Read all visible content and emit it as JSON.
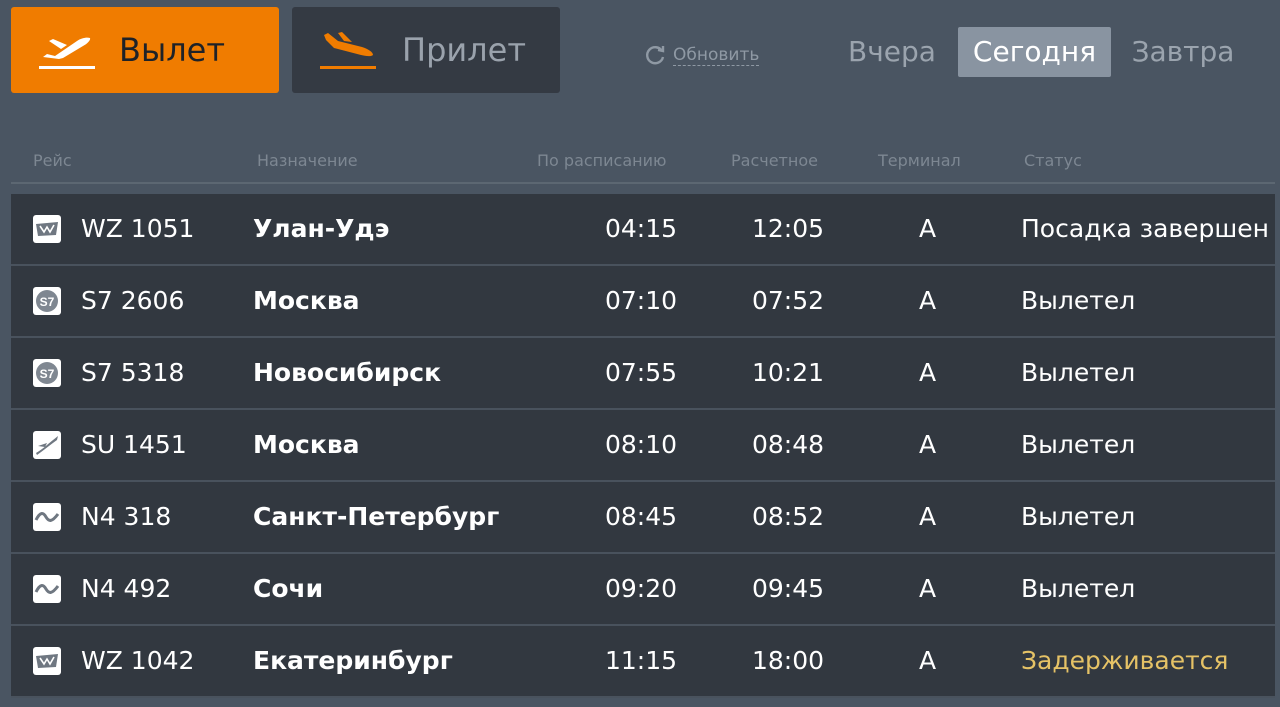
{
  "tabs": {
    "departure_label": "Вылет",
    "arrival_label": "Прилет"
  },
  "refresh_label": "Обновить",
  "days": {
    "yesterday": "Вчера",
    "today": "Сегодня",
    "tomorrow": "Завтра"
  },
  "columns": {
    "flight": "Рейс",
    "destination": "Назначение",
    "scheduled": "По расписанию",
    "estimated": "Расчетное",
    "terminal": "Терминал",
    "status": "Статус"
  },
  "colors": {
    "accent": "#f07c00",
    "delayed": "#e5c266"
  },
  "flights": [
    {
      "logo": "wz-logo-icon",
      "flight": "WZ 1051",
      "destination": "Улан-Удэ",
      "scheduled": "04:15",
      "estimated": "12:05",
      "terminal": "A",
      "status": "Посадка завершен",
      "delayed": false
    },
    {
      "logo": "s7-logo-icon",
      "flight": "S7 2606",
      "destination": "Москва",
      "scheduled": "07:10",
      "estimated": "07:52",
      "terminal": "A",
      "status": "Вылетел",
      "delayed": false
    },
    {
      "logo": "s7-logo-icon",
      "flight": "S7 5318",
      "destination": "Новосибирск",
      "scheduled": "07:55",
      "estimated": "10:21",
      "terminal": "A",
      "status": "Вылетел",
      "delayed": false
    },
    {
      "logo": "su-logo-icon",
      "flight": "SU 1451",
      "destination": "Москва",
      "scheduled": "08:10",
      "estimated": "08:48",
      "terminal": "A",
      "status": "Вылетел",
      "delayed": false
    },
    {
      "logo": "n4-logo-icon",
      "flight": "N4 318",
      "destination": "Санкт-Петербург",
      "scheduled": "08:45",
      "estimated": "08:52",
      "terminal": "A",
      "status": "Вылетел",
      "delayed": false
    },
    {
      "logo": "n4-logo-icon",
      "flight": "N4 492",
      "destination": "Сочи",
      "scheduled": "09:20",
      "estimated": "09:45",
      "terminal": "A",
      "status": "Вылетел",
      "delayed": false
    },
    {
      "logo": "wz-logo-icon",
      "flight": "WZ 1042",
      "destination": "Екатеринбург",
      "scheduled": "11:15",
      "estimated": "18:00",
      "terminal": "A",
      "status": "Задерживается",
      "delayed": true
    }
  ]
}
